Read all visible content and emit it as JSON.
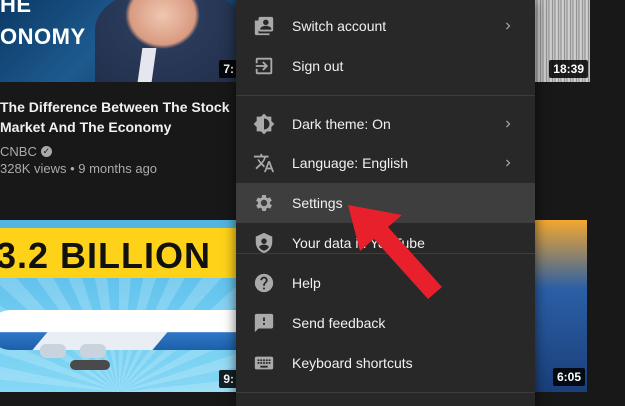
{
  "background": {
    "video_1": {
      "headline_line1": "HE",
      "headline_line2": "ONOMY",
      "duration": "7:",
      "title_line1": "The Difference Between The Stock",
      "title_line2": "Market And The Economy",
      "channel": "CNBC",
      "meta": "328K views • 9 months ago"
    },
    "video_2": {
      "duration": "18:39"
    },
    "video_3": {
      "banner_text": "3.2 BILLION",
      "duration": "9:"
    },
    "video_4": {
      "duration": "6:05"
    }
  },
  "menu": {
    "items": [
      {
        "label": "Switch account",
        "icon": "switch-account-icon",
        "has_chevron": true
      },
      {
        "label": "Sign out",
        "icon": "sign-out-icon",
        "has_chevron": false
      },
      {
        "label": "Dark theme: On",
        "icon": "dark-theme-icon",
        "has_chevron": true
      },
      {
        "label": "Language: English",
        "icon": "language-icon",
        "has_chevron": true
      },
      {
        "label": "Settings",
        "icon": "settings-gear-icon",
        "has_chevron": false,
        "highlighted": true
      },
      {
        "label": "Your data in YouTube",
        "icon": "your-data-shield-icon",
        "has_chevron": false
      },
      {
        "label": "Help",
        "icon": "help-icon",
        "has_chevron": false
      },
      {
        "label": "Send feedback",
        "icon": "feedback-icon",
        "has_chevron": false
      },
      {
        "label": "Keyboard shortcuts",
        "icon": "keyboard-icon",
        "has_chevron": false
      }
    ]
  },
  "colors": {
    "menu_bg": "#282828",
    "menu_highlight": "#3e3e3e",
    "page_bg": "#181818",
    "annotation_arrow": "#e8202c"
  }
}
